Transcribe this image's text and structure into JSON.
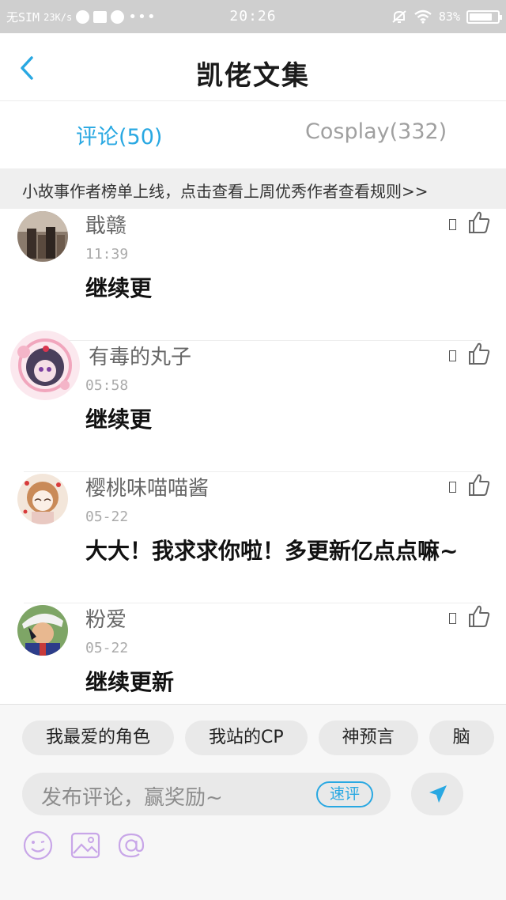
{
  "status_bar": {
    "carrier": "无SIM",
    "speed": "23K/s",
    "more": "•••",
    "time": "20:26",
    "battery": "83%",
    "battery_level": 0.83
  },
  "header": {
    "title": "凯佬文集"
  },
  "tabs": [
    {
      "label": "评论(50)",
      "active": true
    },
    {
      "label": "Cosplay(332)",
      "active": false
    }
  ],
  "notice": {
    "text": "小故事作者榜单上线，点击查看上周优秀作者",
    "link": "查看规则>>"
  },
  "comments": [
    {
      "username": "戢赣",
      "time": "11:39",
      "text": "继续更"
    },
    {
      "username": "有毒的丸子",
      "time": "05:58",
      "text": "继续更"
    },
    {
      "username": "樱桃味喵喵酱",
      "time": "05-22",
      "text": "大大！我求求你啦！多更新亿点点嘛~"
    },
    {
      "username": "粉爱",
      "time": "05-22",
      "text": "继续更新"
    }
  ],
  "bottom": {
    "chips": [
      "我最爱的角色",
      "我站的CP",
      "神预言",
      "脑"
    ],
    "input_placeholder": "发布评论，赢奖励~",
    "quick_comment": "速评"
  },
  "colors": {
    "accent": "#29a8e2",
    "status_bar_bg": "#cfcfcf",
    "notice_bg": "#efefef",
    "tool_icon": "#c8a6e8"
  },
  "icons": {
    "back": "chevron-left-icon",
    "like": "thumbs-up-icon",
    "send": "paper-plane-icon",
    "emoji": "smiley-icon",
    "image": "image-icon",
    "mention": "at-icon"
  }
}
